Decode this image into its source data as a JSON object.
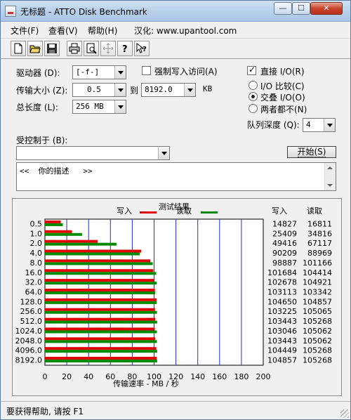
{
  "window": {
    "title": "无标题 - ATTO Disk Benchmark"
  },
  "menu": [
    "文件(F)",
    "查看(V)",
    "帮助(H)",
    "汉化: www.upantool.com"
  ],
  "toolbar": [
    "new-icon",
    "open-icon",
    "save-icon",
    "print-icon",
    "print-preview-icon",
    "move-icon",
    "help-icon",
    "context-help-icon"
  ],
  "settings": {
    "drive_label": "驱动器 (D):",
    "drive_value": "[-f-]",
    "force_write_label": "强制写入访问(A)",
    "force_write_checked": false,
    "transfer_label": "传输大小 (Z):",
    "transfer_from": "0.5",
    "to_label": "到",
    "transfer_to": "8192.0",
    "unit": "KB",
    "total_label": "总长度 (L):",
    "total_value": "256 MB",
    "direct_io_label": "直接 I/O(R)",
    "direct_io_checked": true,
    "io_compare_label": "I/O 比较(C)",
    "overlap_io_label": "交叠 I/O(O)",
    "neither_label": "两者都不(N)",
    "selected_io": "overlap",
    "queue_label": "队列深度 (Q):",
    "queue_value": "4",
    "controlled_label": "受控制于 (B):",
    "controlled_value": "",
    "start_button": "开始(S)",
    "description": "<<  你的描述   >>"
  },
  "chart_data": {
    "type": "bar",
    "title": "测试结果",
    "legend": [
      {
        "name": "写入",
        "color": "#e00000"
      },
      {
        "name": "读取",
        "color": "#008c00"
      }
    ],
    "xlabel": "传输速率 - MB / 秒",
    "xlim": [
      0,
      200
    ],
    "xticks": [
      "0",
      "20",
      "40",
      "60",
      "80",
      "100",
      "120",
      "140",
      "160",
      "180",
      "200"
    ],
    "categories": [
      "0.5",
      "1.0",
      "2.0",
      "4.0",
      "8.0",
      "16.0",
      "32.0",
      "64.0",
      "128.0",
      "256.0",
      "512.0",
      "1024.0",
      "2048.0",
      "4096.0",
      "8192.0"
    ],
    "series": [
      {
        "name": "写入",
        "color": "#e00000",
        "values": [
          14827,
          25409,
          49416,
          90209,
          98887,
          101684,
          102678,
          103113,
          104650,
          103225,
          103443,
          103046,
          103443,
          104449,
          104857
        ]
      },
      {
        "name": "读取",
        "color": "#008c00",
        "values": [
          16811,
          34816,
          67117,
          88969,
          101166,
          104414,
          104921,
          103342,
          104857,
          105065,
          105268,
          105062,
          105062,
          105268,
          105268
        ]
      }
    ],
    "value_unit_note": "KB/s",
    "column_headers": [
      "写入",
      "读取"
    ]
  },
  "status": {
    "text": "要获得帮助, 请按 F1"
  }
}
